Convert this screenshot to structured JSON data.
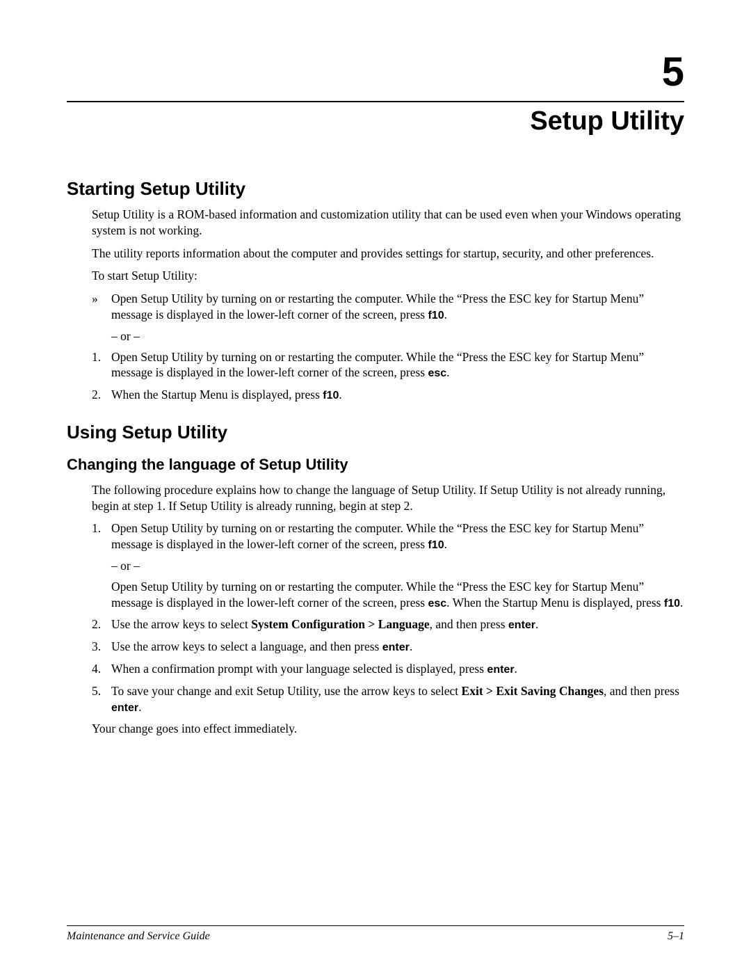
{
  "chapter": {
    "number": "5",
    "title": "Setup Utility"
  },
  "s1": {
    "heading": "Starting Setup Utility",
    "p1": "Setup Utility is a ROM-based information and customization utility that can be used even when your Windows operating system is not working.",
    "p2": "The utility reports information about the computer and provides settings for startup, security, and other preferences.",
    "p3": "To start Setup Utility:",
    "bullet_marker": "»",
    "bullet_a": "Open Setup Utility by turning on or restarting the computer. While the “Press the ESC key for Startup Menu” message is displayed in the lower-left corner of the screen, press ",
    "bullet_key": "f10",
    "bullet_tail": ".",
    "or": "– or –",
    "n1_a": "Open Setup Utility by turning on or restarting the computer. While the “Press the ESC key for Startup Menu” message is displayed in the lower-left corner of the screen, press ",
    "n1_key": "esc",
    "n1_tail": ".",
    "n2_a": "When the Startup Menu is displayed, press ",
    "n2_key": "f10",
    "n2_tail": "."
  },
  "s2": {
    "heading": "Using Setup Utility",
    "sub": "Changing the language of Setup Utility",
    "intro": "The following procedure explains how to change the language of Setup Utility. If Setup Utility is not already running, begin at step 1. If Setup Utility is already running, begin at step 2.",
    "n1_a": "Open Setup Utility by turning on or restarting the computer. While the “Press the ESC key for Startup Menu” message is displayed in the lower-left corner of the screen, press ",
    "n1_key": "f10",
    "n1_tail": ".",
    "or": "– or –",
    "alt_a": "Open Setup Utility by turning on or restarting the computer. While the “Press the ESC key for Startup Menu” message is displayed in the lower-left corner of the screen, press ",
    "alt_key1": "esc",
    "alt_mid": ". When the Startup Menu is displayed, press ",
    "alt_key2": "f10",
    "alt_tail": ".",
    "n2_a": "Use the arrow keys to select ",
    "n2_bold": "System Configuration > Language",
    "n2_mid": ", and then press ",
    "n2_key": "enter",
    "n2_tail": ".",
    "n3_a": "Use the arrow keys to select a language, and then press ",
    "n3_key": "enter",
    "n3_tail": ".",
    "n4_a": "When a confirmation prompt with your language selected is displayed, press ",
    "n4_key": "enter",
    "n4_tail": ".",
    "n5_a": "To save your change and exit Setup Utility, use the arrow keys to select ",
    "n5_bold": "Exit > Exit Saving Changes",
    "n5_mid": ", and then press ",
    "n5_key": "enter",
    "n5_tail": ".",
    "closing": "Your change goes into effect immediately."
  },
  "footer": {
    "left": "Maintenance and Service Guide",
    "right": "5–1"
  },
  "markers": {
    "one": "1.",
    "two": "2.",
    "three": "3.",
    "four": "4.",
    "five": "5."
  }
}
